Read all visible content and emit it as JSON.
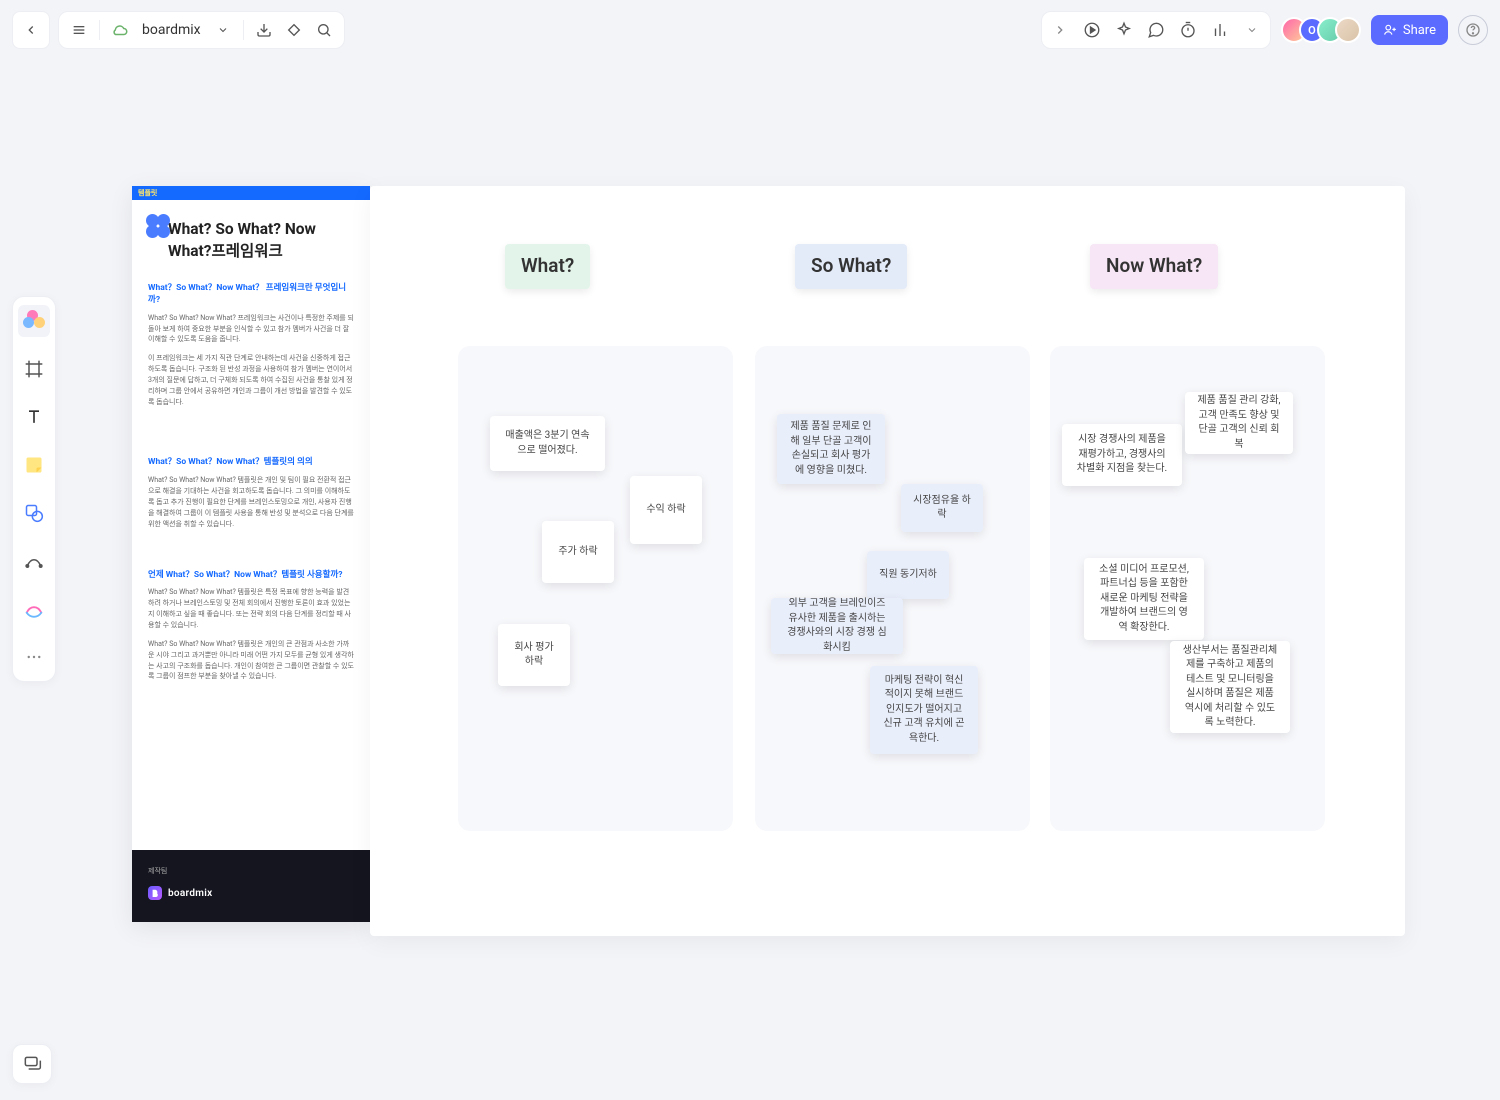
{
  "app": {
    "doc_title": "boardmix",
    "share_label": "Share"
  },
  "avatars": {
    "a2_initial": "O"
  },
  "info_panel": {
    "tag": "템플릿",
    "title": "What? So What? Now What?프레임워크",
    "section1_title": "What？So What？Now What？ 프레임워크란 무엇입니까?",
    "section1_p1": "What? So What? Now What? 프레임워크는 사건이나 특정한 주제를 되돌아 보게 하여 중요한 부분을 인식할 수 있고 참가 멤버가 사건을 더 잘 이해할 수 있도록 도움을 줍니다.",
    "section1_p2": "이 프레임워크는 세 가지 직관 단계로 안내하는데 사건을 신중하게 접근하도록 돕습니다. 구조화 된 반성 과정을 사용하여 참가 멤버는 연이어서 3개의 질문에 답하고, 더 구체화 되도록 하여 수집된 사건을 통찰 있게 정리하며 그룹 안에서 공유하면 개인과 그룹이 개선 방법을 발견할 수 있도록 돕습니다.",
    "section2_title": "What？So What？Now What？템플릿의 의의",
    "section2_p1": "What? So What? Now What? 템플릿은 개인 및 팀이 필요 전환적 접근으로 해결을 기대하는 사건을 회고하도록 돕습니다. 그 의미를 이해하도록 돕고 추가 진행이 필요한 단계를 브레인스토밍으로 개인, 사용자 진행을 해결하여 그룹이 이 템플릿 사용을 통해 반성 및 분석으로 다음 단계를 위한 액션을 취할 수 있습니다.",
    "section3_title": "언제 What？So What？Now What？템플릿 사용할까?",
    "section3_p1": "What? So What? Now What? 템플릿은 특정 목표에 향한 능력을 발견하려 하거나 브레인스토밍 및 전체 회의에서 진행한 토론이 효과 있었는지 이해하고 싶을 때 좋습니다. 또는 전략 회의 다음 단계를 정리할 때 사용할 수 있습니다.",
    "section3_p2": "What? So What? Now What? 템플릿은 개인의 큰 관점과 사소한 가까운 시야 그리고 과거뿐만 아니라 미래 어떤 가지 모두를 균형 있게 생각하는 사고의 구조화를 돕습니다. 개인이 참여한 큰 그룹이면 관찰할 수 있도록 그룹이 점프한 부분을 찾아낼 수 있습니다.",
    "footer_made": "제작팀",
    "footer_brand": "boardmix"
  },
  "columns": {
    "what_label": "What?",
    "sowhat_label": "So What?",
    "nowwhat_label": "Now What?"
  },
  "notes": {
    "what": [
      "매출액은 3분기 연속으로 떨어졌다.",
      "수익 하락",
      "주가 하락",
      "회사 평가 하락"
    ],
    "sowhat": [
      "제품 품질 문제로 인해 일부 단골 고객이 손실되고 회사 평가에 영향을 미쳤다.",
      "시장점유율 하락",
      "직원 동기저하",
      "외부 고객을 브레인이즈 유사한 제품을 출시하는 경쟁사와의 시장 경쟁 심화시킴",
      "마케팅 전략이 혁신적이지 못해 브랜드 인지도가 떨어지고 신규 고객 유치에 곤욕한다."
    ],
    "nowwhat": [
      "시장 경쟁사의 제품을 재평가하고, 경쟁사의 차별화 지점을 찾는다.",
      "제품 품질 관리 강화, 고객 만족도 향상 및 단골 고객의 신뢰 회복",
      "소셜 미디어 프로모션, 파트너십 등을 포함한 새로운 마케팅 전략을 개발하여 브랜드의 영역 확장한다.",
      "생산부서는 품질관리체제를 구축하고 제품의 테스트 및 모니터링을 실시하며 품질은 제품 역시에 처리할 수 있도록 노력한다."
    ]
  }
}
